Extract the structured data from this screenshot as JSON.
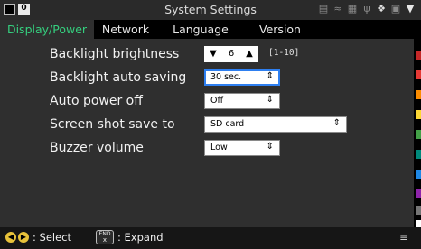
{
  "window": {
    "title": "System Settings"
  },
  "topbar": {
    "badge": "0",
    "status_icons": [
      "printer-icon",
      "wifi-icon",
      "network-icon",
      "usb-icon",
      "bluetooth-icon",
      "sd-card-icon",
      "power-plug-icon"
    ]
  },
  "tabs": [
    {
      "label": "Display/Power",
      "active": true
    },
    {
      "label": "Network",
      "active": false
    },
    {
      "label": "Language",
      "active": false
    },
    {
      "label": "Version",
      "active": false
    }
  ],
  "settings": {
    "backlight_brightness": {
      "label": "Backlight brightness",
      "value": "6",
      "range": "[1-10]"
    },
    "backlight_auto_saving": {
      "label": "Backlight auto saving",
      "value": "30 sec."
    },
    "auto_power_off": {
      "label": "Auto power off",
      "value": "Off"
    },
    "screen_shot_save_to": {
      "label": "Screen shot save to",
      "value": "SD card"
    },
    "buzzer_volume": {
      "label": "Buzzer volume",
      "value": "Low"
    }
  },
  "footer": {
    "select_label": ": Select",
    "end_key_top": "END",
    "end_key_bottom": "x",
    "expand_label": ": Expand"
  },
  "colors": {
    "active_tab_text": "#35d07f",
    "focus_border": "#2e7ff0",
    "nav_button": "#e8c23a",
    "side_strip": [
      "#c62828",
      "#e53935",
      "#fb8c00",
      "#fdd835",
      "#43a047",
      "#00897b",
      "#1e88e5",
      "#8e24aa",
      "#757575",
      "#ffffff"
    ]
  }
}
